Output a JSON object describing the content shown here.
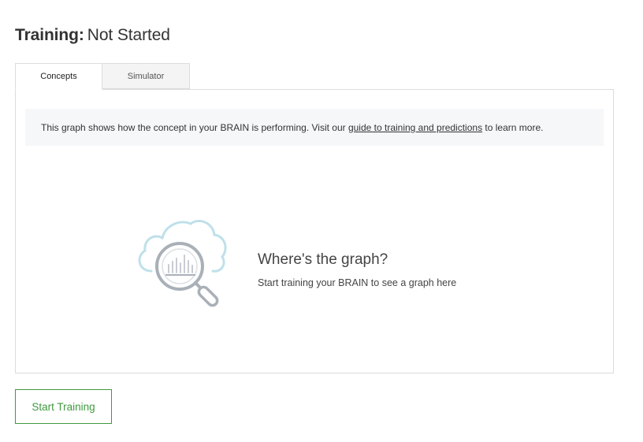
{
  "header": {
    "title_label": "Training:",
    "title_status": "Not Started"
  },
  "tabs": [
    {
      "label": "Concepts",
      "active": true
    },
    {
      "label": "Simulator",
      "active": false
    }
  ],
  "info": {
    "text_before": "This graph shows how the concept in your BRAIN is performing. Visit our ",
    "link_text": "guide to training and predictions",
    "text_after": " to learn more."
  },
  "empty_state": {
    "icon": "cloud-magnifier-chart-icon",
    "heading": "Where's the graph?",
    "subtext": "Start training your BRAIN to see a graph here"
  },
  "actions": {
    "start_label": "Start Training"
  },
  "colors": {
    "accent_green": "#3f9a3f",
    "cloud_blue": "#bfe0ea",
    "icon_gray": "#a9b0b8"
  }
}
